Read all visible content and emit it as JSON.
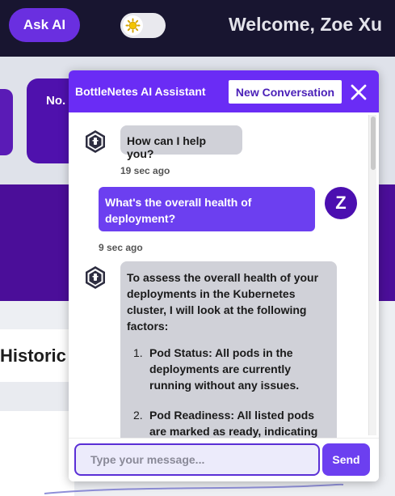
{
  "header": {
    "ask_ai_label": "Ask AI",
    "welcome_text": "Welcome, Zoe Xu",
    "theme_icon": "sun-icon"
  },
  "dashboard": {
    "card_label": "No.",
    "history_label": "Historic"
  },
  "chat": {
    "title": "BottleNetes AI Assistant",
    "new_conversation_label": "New Conversation",
    "close_icon": "close-icon",
    "messages": [
      {
        "sender": "bot",
        "text": "How can I help you?",
        "time": "19 sec ago"
      },
      {
        "sender": "user",
        "avatar_letter": "Z",
        "text": "What's the overall health of deployment?",
        "time": "9 sec ago"
      },
      {
        "sender": "bot",
        "intro": "To assess the overall health of your deployments in the Kubernetes cluster, I will look at the following factors:",
        "items": [
          {
            "num": "1.",
            "title": "Pod Status:",
            "text": "All pods in the deployments are currently running without any issues."
          },
          {
            "num": "2.",
            "title": "Pod Readiness:",
            "text": "All listed pods are marked as ready, indicating"
          }
        ]
      }
    ],
    "input_placeholder": "Type your message...",
    "send_label": "Send"
  },
  "colors": {
    "topbar": "#181530",
    "accent": "#6a2cf5",
    "deep_purple": "#4b0e99",
    "bot_bubble": "#d0d1d8"
  }
}
